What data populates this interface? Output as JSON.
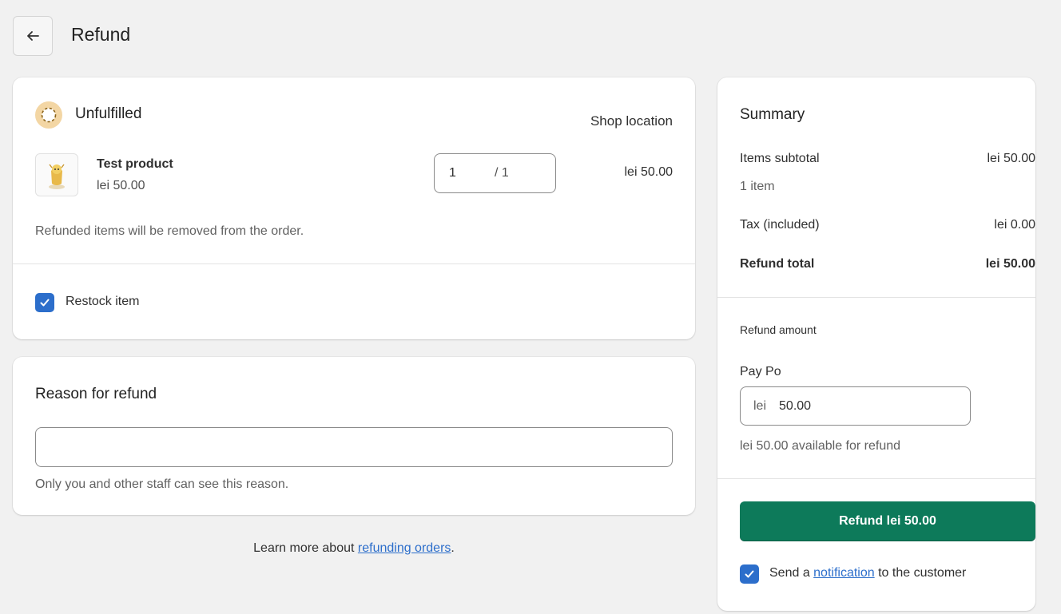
{
  "header": {
    "back_icon": "arrow-left-icon",
    "title": "Refund"
  },
  "items_card": {
    "status_icon": "unfulfilled-status-icon",
    "status_icon_color": "#f3d6a4",
    "status_label": "Unfulfilled",
    "location": "Shop location",
    "product": {
      "thumbnail_icon": "product-thumbnail",
      "name": "Test product",
      "price": "lei 50.00",
      "quantity_value": "1",
      "quantity_max": "/ 1",
      "line_total": "lei 50.00"
    },
    "removed_note": "Refunded items will be removed from the order.",
    "restock": {
      "checked": true,
      "label": "Restock item"
    }
  },
  "reason_card": {
    "title": "Reason for refund",
    "input_value": "",
    "help": "Only you and other staff can see this reason."
  },
  "learn_more": {
    "prefix": "Learn more about ",
    "link": "refunding orders",
    "suffix": "."
  },
  "summary": {
    "title": "Summary",
    "items_subtotal_label": "Items subtotal",
    "items_subtotal_value": "lei 50.00",
    "items_count": "1 item",
    "tax_label": "Tax (included)",
    "tax_value": "lei 0.00",
    "refund_total_label": "Refund total",
    "refund_total_value": "lei 50.00",
    "refund_amount_heading": "Refund amount",
    "payment_method": "Pay Po",
    "amount_prefix": "lei",
    "amount_value": "50.00",
    "available_note": "lei 50.00 available for refund",
    "refund_button": "Refund lei 50.00",
    "refund_button_color": "#0d7a5a",
    "notify": {
      "checked": true,
      "prefix": "Send a ",
      "link": "notification",
      "suffix": " to the customer"
    }
  },
  "colors": {
    "background": "#f1f1f1",
    "checkbox": "#2c6ecb",
    "link": "#2c6ecb"
  }
}
